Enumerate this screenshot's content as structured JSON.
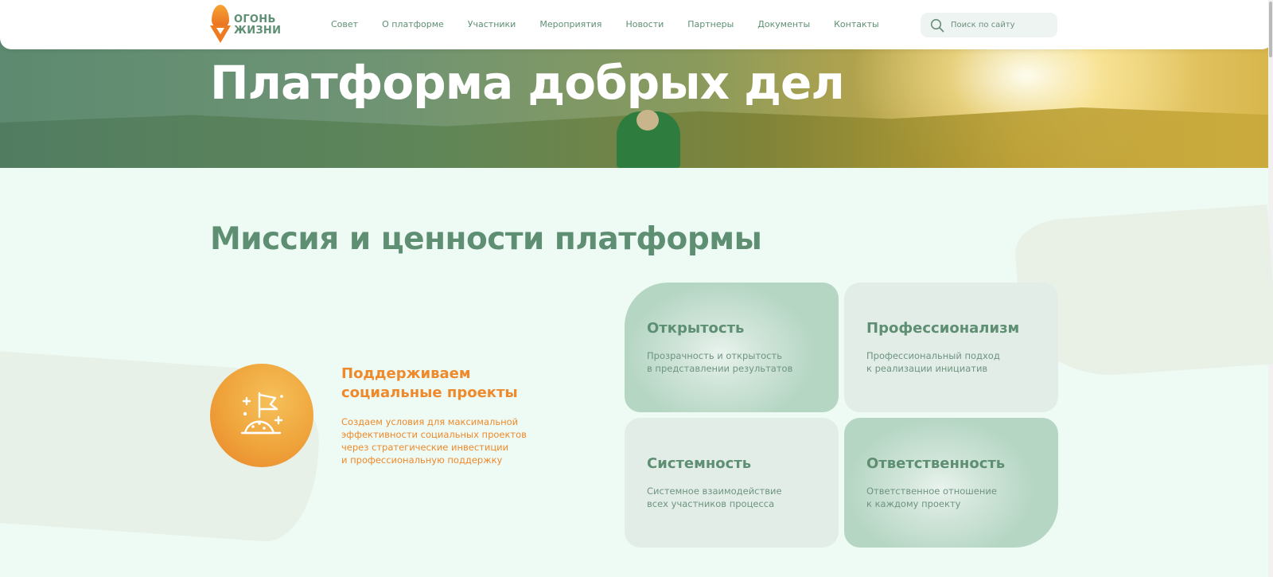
{
  "header": {
    "logo": {
      "line1": "ОГОНЬ",
      "line2": "ЖИЗНИ"
    },
    "nav": [
      {
        "label": "Совет"
      },
      {
        "label": "О платформе"
      },
      {
        "label": "Участники"
      },
      {
        "label": "Мероприятия"
      },
      {
        "label": "Новости"
      },
      {
        "label": "Партнеры"
      },
      {
        "label": "Документы"
      },
      {
        "label": "Контакты"
      }
    ],
    "search": {
      "placeholder": "Поиск по сайту",
      "icon": "search-icon"
    }
  },
  "hero": {
    "title": "Платформа добрых дел"
  },
  "mission": {
    "title": "Миссия и ценности платформы",
    "feature": {
      "icon": "flag-on-hill-icon",
      "title_lines": [
        "Поддерживаем",
        "социальные проекты"
      ],
      "text_lines": [
        "Создаем условия для максимальной",
        "эффективности социальных проектов",
        "через стратегические инвестиции",
        "и профессиональную поддержку"
      ]
    },
    "values": [
      {
        "title": "Открытость",
        "text_lines": [
          "Прозрачность и открытость",
          "в представлении результатов"
        ]
      },
      {
        "title": "Профессионализм",
        "text_lines": [
          "Профессиональный подход",
          "к реализации инициатив"
        ]
      },
      {
        "title": "Системность",
        "text_lines": [
          "Системное взаимодействие",
          "всех участников процесса"
        ]
      },
      {
        "title": "Ответственность",
        "text_lines": [
          "Ответственное отношение",
          "к каждому проекту"
        ]
      }
    ]
  },
  "colors": {
    "brand_green": "#5e8f73",
    "brand_orange": "#ee8a2c",
    "page_background": "#eefaf4"
  }
}
